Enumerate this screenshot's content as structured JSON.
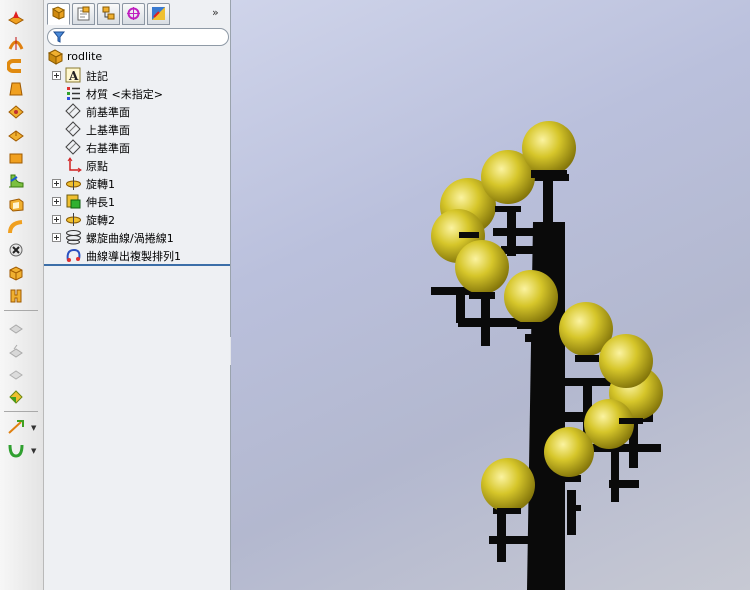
{
  "toolbar": {
    "icons": [
      "extruded-boss-icon",
      "revolved-boss-icon",
      "swept-boss-icon",
      "lofted-boss-icon",
      "boundary-boss-icon",
      "thicken-icon",
      "plane-icon",
      "fillet-icon",
      "shell-icon",
      "wrap-icon",
      "hole-wizard-icon",
      "extruded-cut-icon",
      "rib-icon",
      "cut-disabled-icon",
      "cut2-disabled-icon",
      "cut3-disabled-icon",
      "intersect-icon",
      "reference-geometry-icon",
      "curves-icon"
    ]
  },
  "panel": {
    "tabs": [
      "feature-manager-tab",
      "property-manager-tab",
      "configuration-manager-tab",
      "dimxpert-manager-tab",
      "display-manager-tab"
    ],
    "more_label": "»",
    "filter_icon": "filter-icon",
    "collapse_label": "‹"
  },
  "tree": {
    "root": {
      "label": "rodlite",
      "icon": "part-icon"
    },
    "items": [
      {
        "label": "註記",
        "icon": "annotations-icon",
        "expandable": true
      },
      {
        "label": "材質 <未指定>",
        "icon": "material-icon",
        "expandable": false
      },
      {
        "label": "前基準面",
        "icon": "plane-icon",
        "expandable": false
      },
      {
        "label": "上基準面",
        "icon": "plane-icon",
        "expandable": false
      },
      {
        "label": "右基準面",
        "icon": "plane-icon",
        "expandable": false
      },
      {
        "label": "原點",
        "icon": "origin-icon",
        "expandable": false
      },
      {
        "label": "旋轉1",
        "icon": "revolve-icon",
        "expandable": true
      },
      {
        "label": "伸長1",
        "icon": "extrude-icon",
        "expandable": true
      },
      {
        "label": "旋轉2",
        "icon": "revolve-icon",
        "expandable": true
      },
      {
        "label": "螺旋曲線/渦捲線1",
        "icon": "helix-icon",
        "expandable": true
      },
      {
        "label": "曲線導出複製排列1",
        "icon": "curve-pattern-icon",
        "expandable": false
      }
    ]
  },
  "viewport": {
    "model": "street-lamp-model",
    "globe_color": "#c8b820",
    "pole_color": "#0a0a0a"
  }
}
